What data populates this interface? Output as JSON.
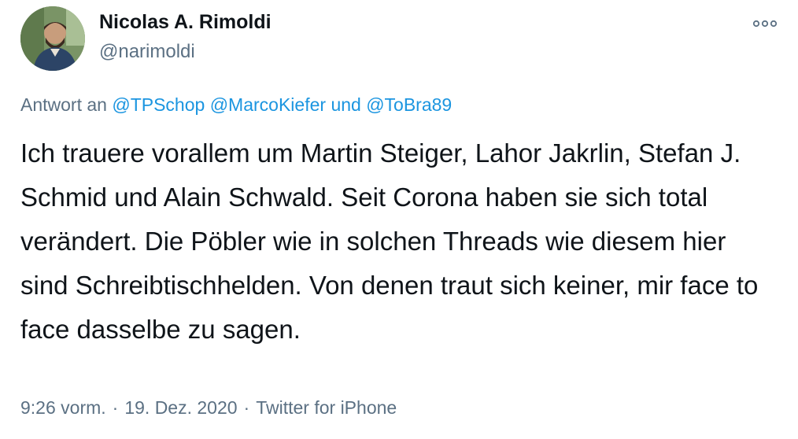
{
  "author": {
    "name": "Nicolas A. Rimoldi",
    "handle": "@narimoldi"
  },
  "reply": {
    "prefix": "Antwort an",
    "mention_1": "@TPSchop",
    "mention_2": "@MarcoKiefer",
    "conjunction": "und",
    "mention_3": "@ToBra89"
  },
  "tweet": {
    "text": "Ich trauere vorallem um Martin Steiger, Lahor Jakrlin, Stefan J. Schmid und Alain Schwald. Seit Corona haben sie sich total verändert. Die Pöbler wie in solchen Threads wie diesem hier sind Schreibtischhelden. Von denen traut sich keiner, mir face to face dasselbe zu sagen."
  },
  "meta": {
    "time": "9:26 vorm.",
    "separator": "·",
    "date": "19. Dez. 2020",
    "source": "Twitter for iPhone"
  },
  "icons": {
    "more": "more-horizontal-icon"
  },
  "colors": {
    "text": "#0f1419",
    "secondary": "#5b7083",
    "link": "#1b95e0"
  }
}
